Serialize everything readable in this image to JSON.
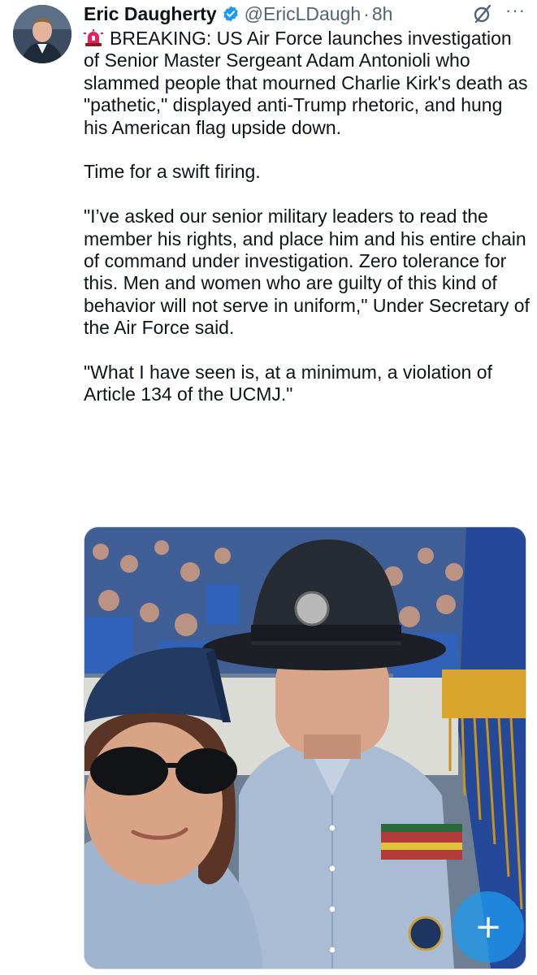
{
  "author": {
    "name": "Eric Daugherty",
    "handle": "@EricLDaugh",
    "separator": "·",
    "time": "8h"
  },
  "icons": {
    "verified": "verified-badge-icon",
    "grok": "grok-icon",
    "more": "more-options-icon",
    "siren": "rotating-light-icon",
    "compose": "compose-plus-icon"
  },
  "more_label": "···",
  "tweet": {
    "para1": "BREAKING: US Air Force launches investigation of Senior Master Sergeant Adam Antonioli who slammed people that mourned Charlie Kirk's death as \"pathetic,\" displayed anti-Trump rhetoric, and hung his American flag upside down.",
    "para2": "Time for a swift firing.",
    "para3": "\"I’ve asked our senior military leaders to read the member his rights, and place him and his entire chain of command under investigation. Zero tolerance for this. Men and women who are guilty of this kind of behavior will not serve in uniform,\" Under Secretary of the Air Force said.",
    "para4": "\"What I have seen is, at a minimum, a violation of Article 134 of the UCMJ.\""
  },
  "compose_label": "+",
  "colors": {
    "accent": "#1d9bf0",
    "text": "#0f1419",
    "secondary": "#536471",
    "siren_red": "#e0245e"
  }
}
